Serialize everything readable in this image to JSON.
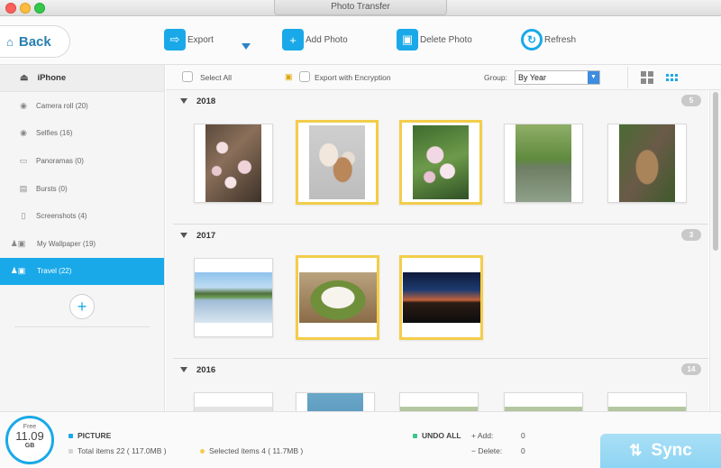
{
  "window": {
    "title": "Photo Transfer"
  },
  "toolbar": {
    "back_label": "Back",
    "export_label": "Export",
    "add_photo_label": "Add Photo",
    "delete_photo_label": "Delete Photo",
    "refresh_label": "Refresh"
  },
  "sidebar": {
    "device": "iPhone",
    "items": [
      {
        "label": "Camera roll (20)",
        "icon": "camera-icon"
      },
      {
        "label": "Selfies (16)",
        "icon": "camera-icon"
      },
      {
        "label": "Panoramas (0)",
        "icon": "panorama-icon"
      },
      {
        "label": "Bursts (0)",
        "icon": "bursts-icon"
      },
      {
        "label": "Screenshots (4)",
        "icon": "phone-icon"
      },
      {
        "label": "My Wallpaper (19)",
        "icon": "user-photo-icon"
      },
      {
        "label": "Travel (22)",
        "icon": "user-photo-icon",
        "active": true
      }
    ]
  },
  "filter": {
    "select_all": "Select All",
    "export_encryption": "Export with Encryption",
    "group_label": "Group:",
    "group_value": "By Year"
  },
  "groups": [
    {
      "year": "2018",
      "count": "5",
      "photos": [
        "blossom",
        "kittens",
        "flowers",
        "willow",
        "chipmunk"
      ],
      "selected": [
        false,
        true,
        true,
        false,
        false
      ]
    },
    {
      "year": "2017",
      "count": "3",
      "photos": [
        "lake",
        "food",
        "sunset"
      ],
      "selected": [
        false,
        true,
        true
      ]
    },
    {
      "year": "2016",
      "count": "14"
    }
  ],
  "bottom": {
    "storage_free_label": "Free",
    "storage_value": "11.09",
    "storage_unit": "GB",
    "category": "PICTURE",
    "total_items": "Total items 22 ( 117.0MB )",
    "selected_items": "Selected items 4 ( 11.7MB )",
    "undo_all": "UNDO ALL",
    "add_label": "+ Add:",
    "add_value": "0",
    "delete_label": "− Delete:",
    "delete_value": "0",
    "sync_label": "Sync"
  },
  "colors": {
    "accent": "#19a9e8",
    "selection": "#f3cd4b"
  }
}
